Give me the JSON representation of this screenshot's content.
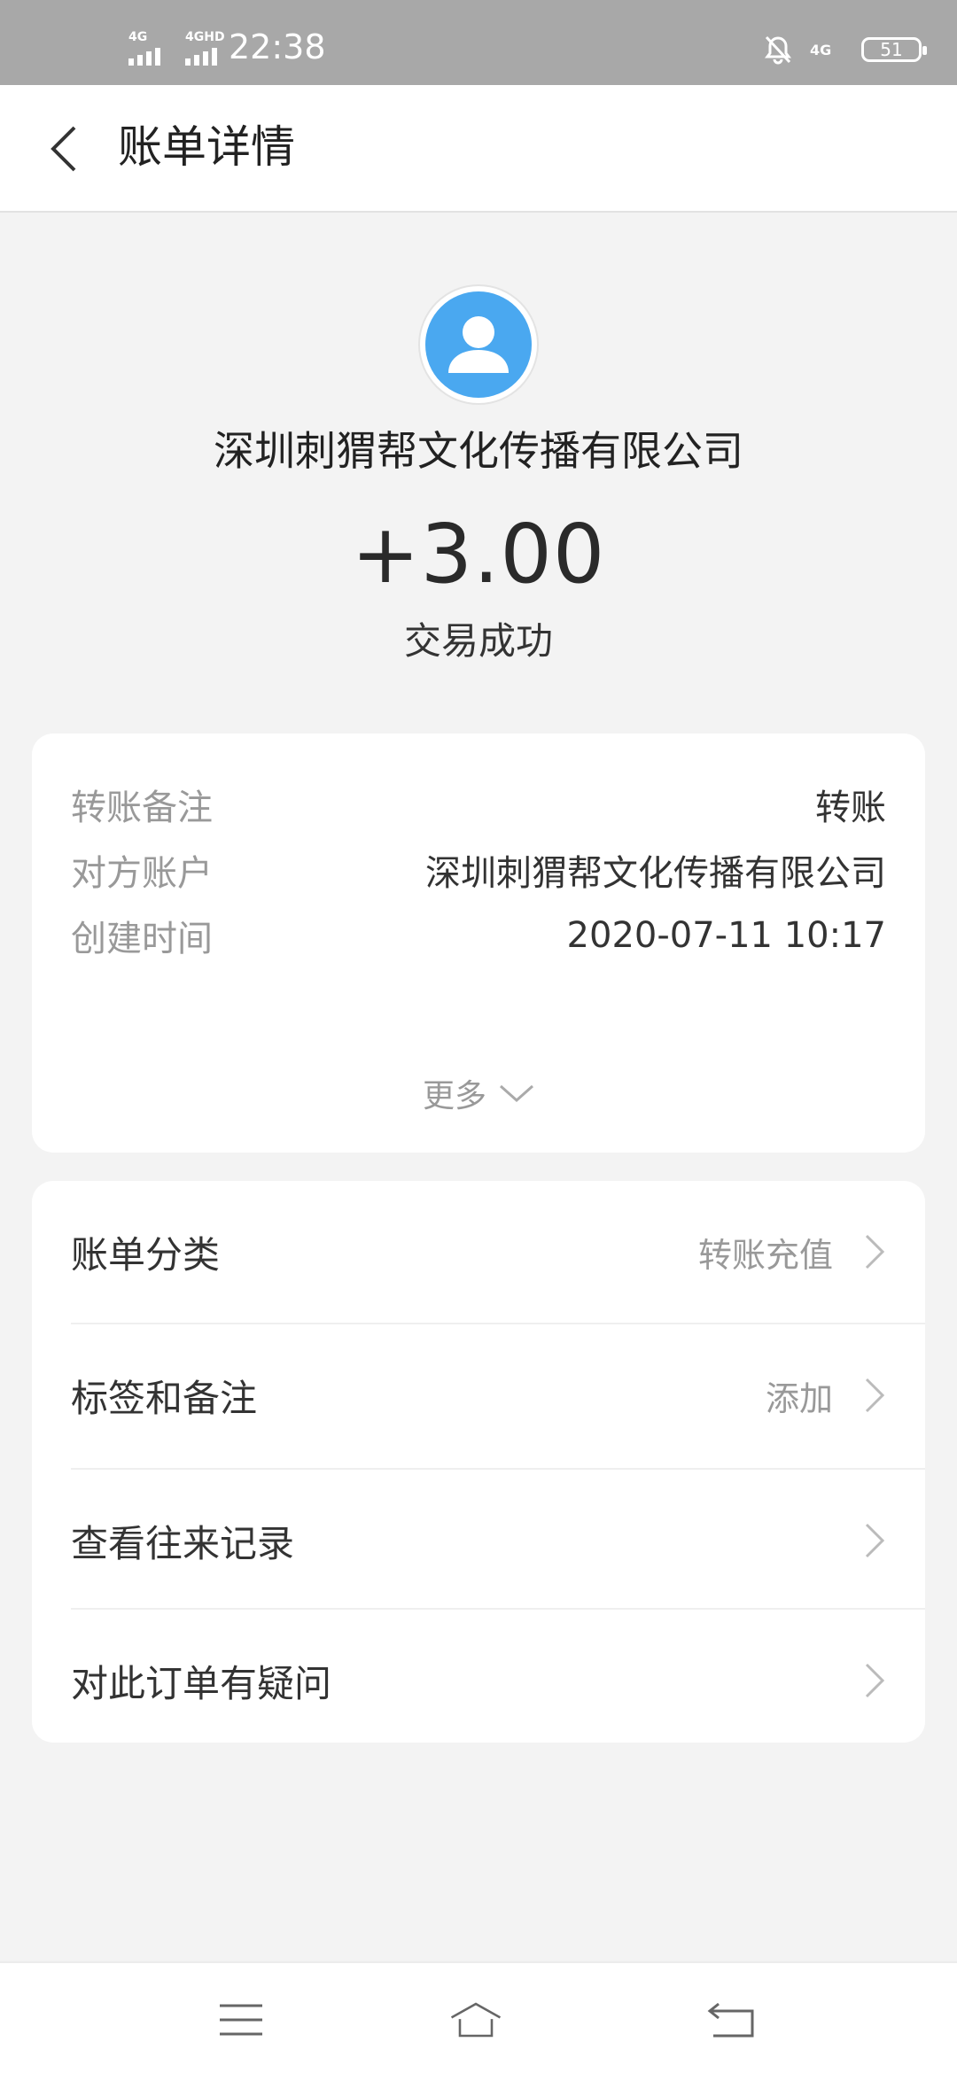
{
  "status_bar": {
    "signal1": "4G",
    "signal2": "4GHD",
    "time": "22:38",
    "network": "4G",
    "battery": "51"
  },
  "header": {
    "title": "账单详情",
    "back_icon": "back-arrow-icon"
  },
  "summary": {
    "avatar_icon": "user-avatar-icon",
    "payee": "深圳刺猬帮文化传播有限公司",
    "amount": "+3.00",
    "status": "交易成功"
  },
  "details": [
    {
      "label": "转账备注",
      "value": "转账"
    },
    {
      "label": "对方账户",
      "value": "深圳刺猬帮文化传播有限公司"
    },
    {
      "label": "创建时间",
      "value": "2020-07-11 10:17"
    }
  ],
  "more_label": "更多",
  "menu": [
    {
      "label": "账单分类",
      "value": "转账充值"
    },
    {
      "label": "标签和备注",
      "value": "添加"
    },
    {
      "label": "查看往来记录",
      "value": ""
    },
    {
      "label": "对此订单有疑问",
      "value": ""
    }
  ],
  "nav": {
    "menu_icon": "menu-icon",
    "home_icon": "home-icon",
    "back_icon": "return-icon"
  },
  "colors": {
    "accent_avatar": "#4aa8f0",
    "status_bar": "#a8a8a8",
    "background": "#f3f3f3"
  }
}
